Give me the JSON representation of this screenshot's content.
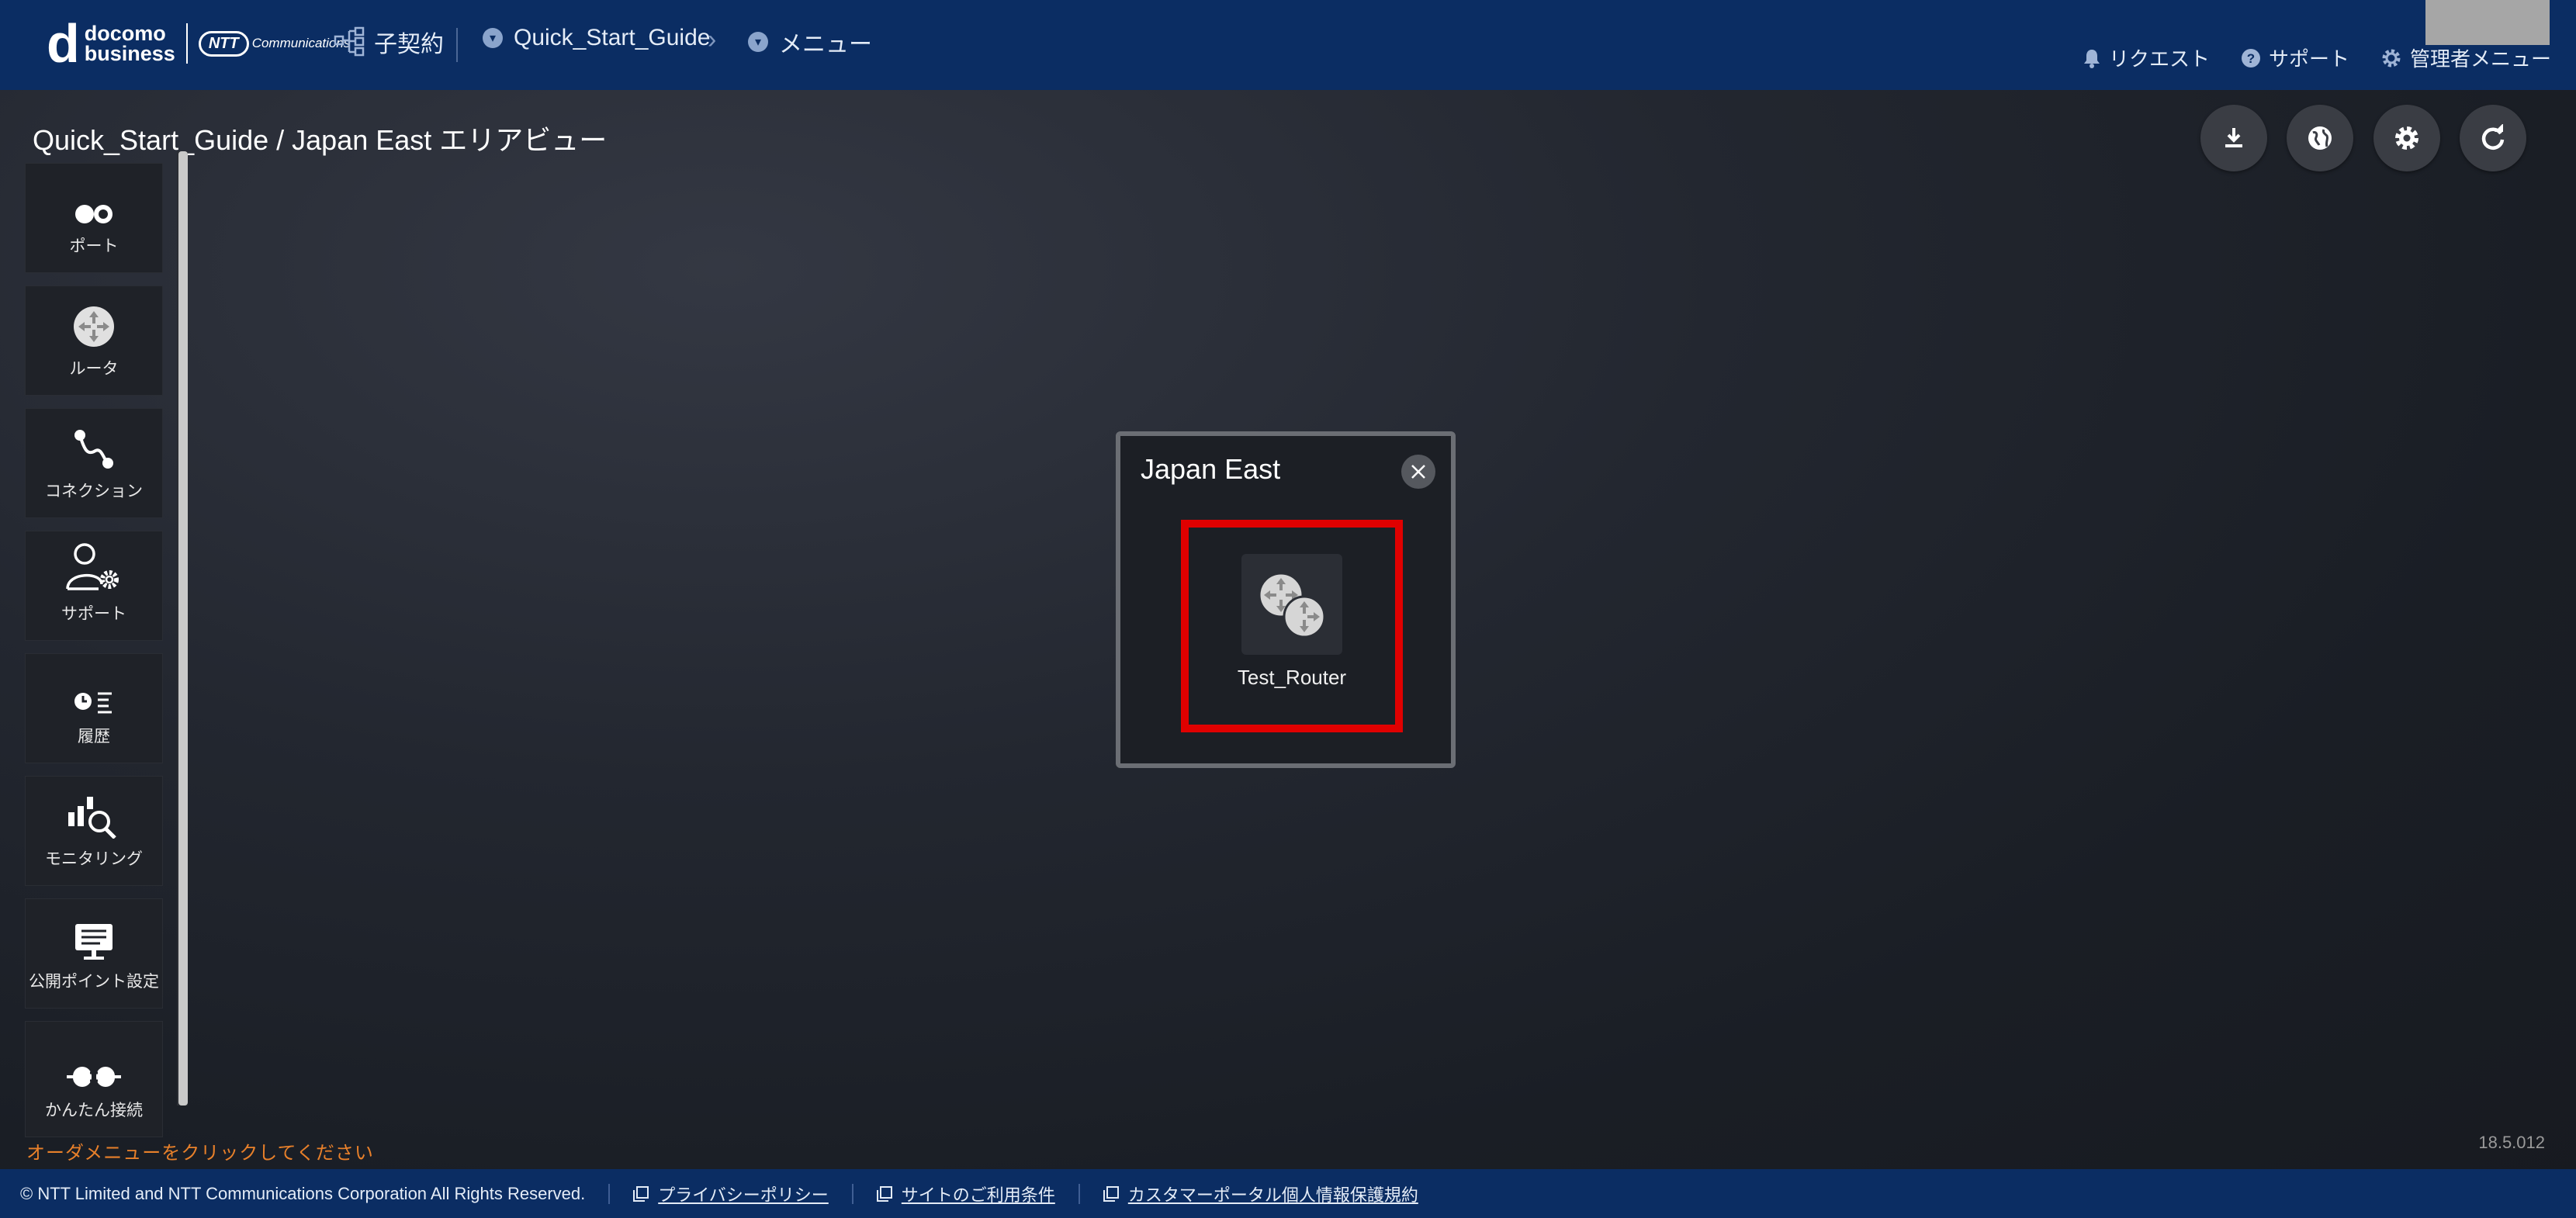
{
  "header": {
    "logo_d": "d",
    "logo_line1": "docomo",
    "logo_line2": "business",
    "ntt_logo": "NTT",
    "ntt_comm": "Communications",
    "contract_label": "子契約",
    "breadcrumb_guide": "Quick_Start_Guide",
    "breadcrumb_menu": "メニュー",
    "request_label": "リクエスト",
    "support_label": "サポート",
    "admin_label": "管理者メニュー"
  },
  "page": {
    "title": "Quick_Start_Guide / Japan East エリアビュー"
  },
  "toolbar": {
    "buttons": [
      "download-icon",
      "globe-icon",
      "gear-icon",
      "refresh-icon"
    ]
  },
  "sidebar": {
    "items": [
      {
        "label": "ポート",
        "icon": "port-icon"
      },
      {
        "label": "ルータ",
        "icon": "router-icon"
      },
      {
        "label": "コネクション",
        "icon": "connection-icon"
      },
      {
        "label": "サポート",
        "icon": "support-user-icon"
      },
      {
        "label": "履歴",
        "icon": "history-icon"
      },
      {
        "label": "モニタリング",
        "icon": "monitoring-icon"
      },
      {
        "label": "公開ポイント設定",
        "icon": "monitor-icon"
      },
      {
        "label": "かんたん接続",
        "icon": "plug-icon"
      }
    ]
  },
  "status": {
    "order_message": "オーダメニューをクリックしてください",
    "version": "18.5.012"
  },
  "popup": {
    "title": "Japan East",
    "router_name": "Test_Router"
  },
  "footer": {
    "copyright": "© NTT Limited and NTT Communications Corporation All Rights Reserved.",
    "privacy": "プライバシーポリシー",
    "terms": "サイトのご利用条件",
    "customer_privacy": "カスタマーポータル個人情報保護規約"
  },
  "colors": {
    "header_bg": "#0b2d63",
    "highlight": "#e00000",
    "order_message": "#e8802a"
  }
}
